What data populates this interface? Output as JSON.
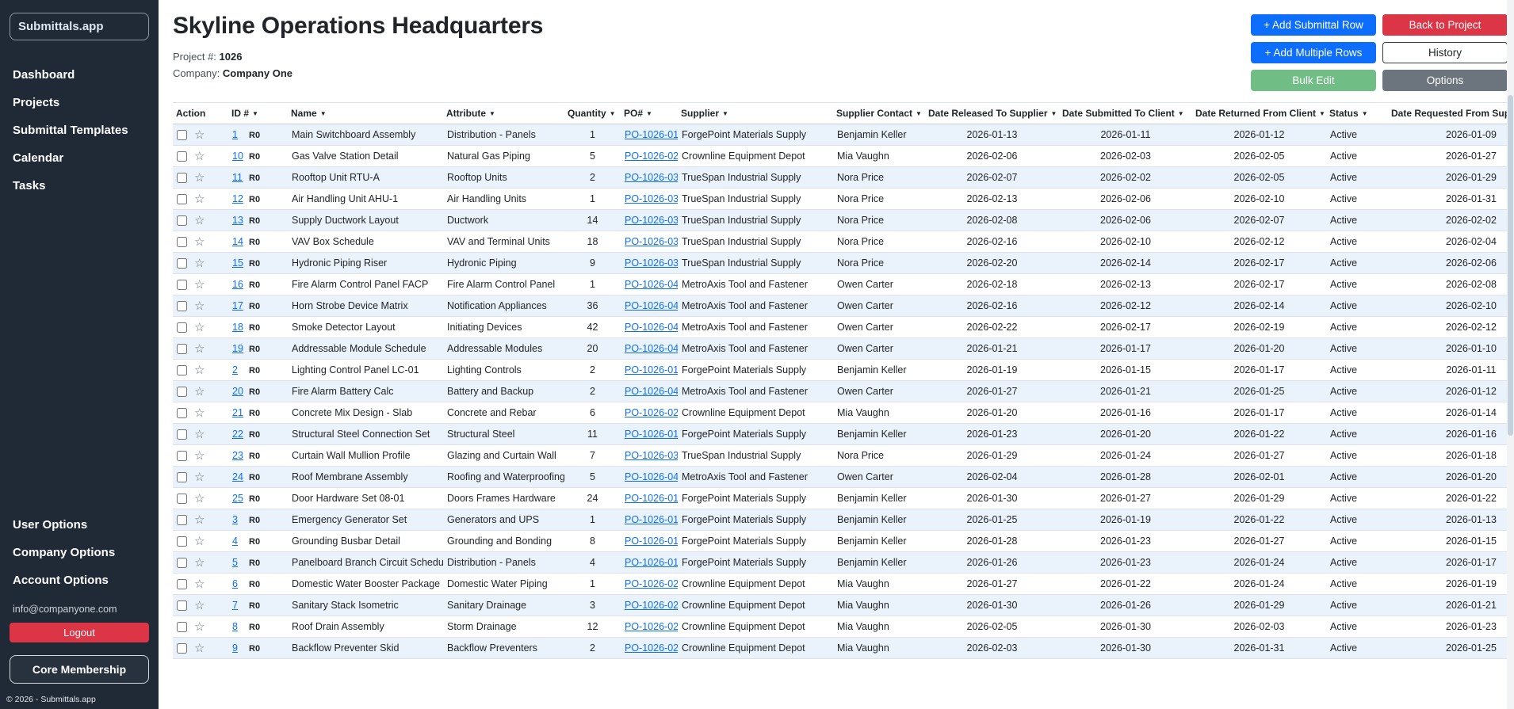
{
  "app": {
    "logo": "Submittals.app",
    "copyright": "© 2026 - Submittals.app"
  },
  "colors": {
    "primary": "#0d6efd",
    "danger": "#dc3545",
    "success": "#70bd86",
    "secondary": "#6c757d",
    "sidebar_bg": "#202a37",
    "row_stripe": "#eaf3fb",
    "link": "#0d6efd"
  },
  "icons": {
    "sort_desc": "▼",
    "star": "☆"
  },
  "sidebar": {
    "nav_items": [
      "Dashboard",
      "Projects",
      "Submittal Templates",
      "Calendar",
      "Tasks"
    ],
    "option_items": [
      "User Options",
      "Company Options",
      "Account Options"
    ],
    "email": "info@companyone.com",
    "logout_label": "Logout",
    "membership_label": "Core Membership"
  },
  "header": {
    "title": "Skyline Operations Headquarters",
    "project_label": "Project #:",
    "project_number": "1026",
    "company_label": "Company:",
    "company_name": "Company One"
  },
  "toolbar": {
    "add_row": "+ Add Submittal Row",
    "back": "Back to Project",
    "add_multiple": "+ Add Multiple Rows",
    "history": "History",
    "bulk_edit": "Bulk Edit",
    "options": "Options"
  },
  "table": {
    "columns": [
      {
        "key": "action",
        "label": "Action",
        "sortable": false
      },
      {
        "key": "id",
        "label": "ID #",
        "sortable": true
      },
      {
        "key": "name",
        "label": "Name",
        "sortable": true
      },
      {
        "key": "attribute",
        "label": "Attribute",
        "sortable": true
      },
      {
        "key": "quantity",
        "label": "Quantity",
        "sortable": true
      },
      {
        "key": "po",
        "label": "PO#",
        "sortable": true
      },
      {
        "key": "supplier",
        "label": "Supplier",
        "sortable": true
      },
      {
        "key": "supplier_contact",
        "label": "Supplier Contact",
        "sortable": true
      },
      {
        "key": "date_released",
        "label": "Date Released To Supplier",
        "sortable": true
      },
      {
        "key": "date_submitted",
        "label": "Date Submitted To Client",
        "sortable": true
      },
      {
        "key": "date_returned",
        "label": "Date Returned From Client",
        "sortable": true
      },
      {
        "key": "status",
        "label": "Status",
        "sortable": true
      },
      {
        "key": "date_requested",
        "label": "Date Requested From Supplier",
        "sortable": true
      }
    ],
    "rows": [
      {
        "id": "1",
        "rev": "R0",
        "name": "Main Switchboard Assembly",
        "attr": "Distribution - Panels",
        "qty": "1",
        "po": "PO-1026-01",
        "supplier": "ForgePoint Materials Supply",
        "contact": "Benjamin Keller",
        "released": "2026-01-13",
        "submitted": "2026-01-11",
        "returned": "2026-01-12",
        "status": "Active",
        "requested": "2026-01-09"
      },
      {
        "id": "10",
        "rev": "R0",
        "name": "Gas Valve Station Detail",
        "attr": "Natural Gas Piping",
        "qty": "5",
        "po": "PO-1026-02",
        "supplier": "Crownline Equipment Depot",
        "contact": "Mia Vaughn",
        "released": "2026-02-06",
        "submitted": "2026-02-03",
        "returned": "2026-02-05",
        "status": "Active",
        "requested": "2026-01-27"
      },
      {
        "id": "11",
        "rev": "R0",
        "name": "Rooftop Unit RTU-A",
        "attr": "Rooftop Units",
        "qty": "2",
        "po": "PO-1026-03",
        "supplier": "TrueSpan Industrial Supply",
        "contact": "Nora Price",
        "released": "2026-02-07",
        "submitted": "2026-02-02",
        "returned": "2026-02-05",
        "status": "Active",
        "requested": "2026-01-29"
      },
      {
        "id": "12",
        "rev": "R0",
        "name": "Air Handling Unit AHU-1",
        "attr": "Air Handling Units",
        "qty": "1",
        "po": "PO-1026-03",
        "supplier": "TrueSpan Industrial Supply",
        "contact": "Nora Price",
        "released": "2026-02-13",
        "submitted": "2026-02-06",
        "returned": "2026-02-10",
        "status": "Active",
        "requested": "2026-01-31"
      },
      {
        "id": "13",
        "rev": "R0",
        "name": "Supply Ductwork Layout",
        "attr": "Ductwork",
        "qty": "14",
        "po": "PO-1026-03",
        "supplier": "TrueSpan Industrial Supply",
        "contact": "Nora Price",
        "released": "2026-02-08",
        "submitted": "2026-02-06",
        "returned": "2026-02-07",
        "status": "Active",
        "requested": "2026-02-02"
      },
      {
        "id": "14",
        "rev": "R0",
        "name": "VAV Box Schedule",
        "attr": "VAV and Terminal Units",
        "qty": "18",
        "po": "PO-1026-03",
        "supplier": "TrueSpan Industrial Supply",
        "contact": "Nora Price",
        "released": "2026-02-16",
        "submitted": "2026-02-10",
        "returned": "2026-02-12",
        "status": "Active",
        "requested": "2026-02-04"
      },
      {
        "id": "15",
        "rev": "R0",
        "name": "Hydronic Piping Riser",
        "attr": "Hydronic Piping",
        "qty": "9",
        "po": "PO-1026-03",
        "supplier": "TrueSpan Industrial Supply",
        "contact": "Nora Price",
        "released": "2026-02-20",
        "submitted": "2026-02-14",
        "returned": "2026-02-17",
        "status": "Active",
        "requested": "2026-02-06"
      },
      {
        "id": "16",
        "rev": "R0",
        "name": "Fire Alarm Control Panel FACP",
        "attr": "Fire Alarm Control Panel",
        "qty": "1",
        "po": "PO-1026-04",
        "supplier": "MetroAxis Tool and Fastener",
        "contact": "Owen Carter",
        "released": "2026-02-18",
        "submitted": "2026-02-13",
        "returned": "2026-02-17",
        "status": "Active",
        "requested": "2026-02-08"
      },
      {
        "id": "17",
        "rev": "R0",
        "name": "Horn Strobe Device Matrix",
        "attr": "Notification Appliances",
        "qty": "36",
        "po": "PO-1026-04",
        "supplier": "MetroAxis Tool and Fastener",
        "contact": "Owen Carter",
        "released": "2026-02-16",
        "submitted": "2026-02-12",
        "returned": "2026-02-14",
        "status": "Active",
        "requested": "2026-02-10"
      },
      {
        "id": "18",
        "rev": "R0",
        "name": "Smoke Detector Layout",
        "attr": "Initiating Devices",
        "qty": "42",
        "po": "PO-1026-04",
        "supplier": "MetroAxis Tool and Fastener",
        "contact": "Owen Carter",
        "released": "2026-02-22",
        "submitted": "2026-02-17",
        "returned": "2026-02-19",
        "status": "Active",
        "requested": "2026-02-12"
      },
      {
        "id": "19",
        "rev": "R0",
        "name": "Addressable Module Schedule",
        "attr": "Addressable Modules",
        "qty": "20",
        "po": "PO-1026-04",
        "supplier": "MetroAxis Tool and Fastener",
        "contact": "Owen Carter",
        "released": "2026-01-21",
        "submitted": "2026-01-17",
        "returned": "2026-01-20",
        "status": "Active",
        "requested": "2026-01-10"
      },
      {
        "id": "2",
        "rev": "R0",
        "name": "Lighting Control Panel LC-01",
        "attr": "Lighting Controls",
        "qty": "2",
        "po": "PO-1026-01",
        "supplier": "ForgePoint Materials Supply",
        "contact": "Benjamin Keller",
        "released": "2026-01-19",
        "submitted": "2026-01-15",
        "returned": "2026-01-17",
        "status": "Active",
        "requested": "2026-01-11"
      },
      {
        "id": "20",
        "rev": "R0",
        "name": "Fire Alarm Battery Calc",
        "attr": "Battery and Backup",
        "qty": "2",
        "po": "PO-1026-04",
        "supplier": "MetroAxis Tool and Fastener",
        "contact": "Owen Carter",
        "released": "2026-01-27",
        "submitted": "2026-01-21",
        "returned": "2026-01-25",
        "status": "Active",
        "requested": "2026-01-12"
      },
      {
        "id": "21",
        "rev": "R0",
        "name": "Concrete Mix Design - Slab",
        "attr": "Concrete and Rebar",
        "qty": "6",
        "po": "PO-1026-02",
        "supplier": "Crownline Equipment Depot",
        "contact": "Mia Vaughn",
        "released": "2026-01-20",
        "submitted": "2026-01-16",
        "returned": "2026-01-17",
        "status": "Active",
        "requested": "2026-01-14"
      },
      {
        "id": "22",
        "rev": "R0",
        "name": "Structural Steel Connection Set",
        "attr": "Structural Steel",
        "qty": "11",
        "po": "PO-1026-01",
        "supplier": "ForgePoint Materials Supply",
        "contact": "Benjamin Keller",
        "released": "2026-01-23",
        "submitted": "2026-01-20",
        "returned": "2026-01-22",
        "status": "Active",
        "requested": "2026-01-16"
      },
      {
        "id": "23",
        "rev": "R0",
        "name": "Curtain Wall Mullion Profile",
        "attr": "Glazing and Curtain Wall",
        "qty": "7",
        "po": "PO-1026-03",
        "supplier": "TrueSpan Industrial Supply",
        "contact": "Nora Price",
        "released": "2026-01-29",
        "submitted": "2026-01-24",
        "returned": "2026-01-27",
        "status": "Active",
        "requested": "2026-01-18"
      },
      {
        "id": "24",
        "rev": "R0",
        "name": "Roof Membrane Assembly",
        "attr": "Roofing and Waterproofing",
        "qty": "5",
        "po": "PO-1026-04",
        "supplier": "MetroAxis Tool and Fastener",
        "contact": "Owen Carter",
        "released": "2026-02-04",
        "submitted": "2026-01-28",
        "returned": "2026-02-01",
        "status": "Active",
        "requested": "2026-01-20"
      },
      {
        "id": "25",
        "rev": "R0",
        "name": "Door Hardware Set 08-01",
        "attr": "Doors Frames Hardware",
        "qty": "24",
        "po": "PO-1026-01",
        "supplier": "ForgePoint Materials Supply",
        "contact": "Benjamin Keller",
        "released": "2026-01-30",
        "submitted": "2026-01-27",
        "returned": "2026-01-29",
        "status": "Active",
        "requested": "2026-01-22"
      },
      {
        "id": "3",
        "rev": "R0",
        "name": "Emergency Generator Set",
        "attr": "Generators and UPS",
        "qty": "1",
        "po": "PO-1026-01",
        "supplier": "ForgePoint Materials Supply",
        "contact": "Benjamin Keller",
        "released": "2026-01-25",
        "submitted": "2026-01-19",
        "returned": "2026-01-22",
        "status": "Active",
        "requested": "2026-01-13"
      },
      {
        "id": "4",
        "rev": "R0",
        "name": "Grounding Busbar Detail",
        "attr": "Grounding and Bonding",
        "qty": "8",
        "po": "PO-1026-01",
        "supplier": "ForgePoint Materials Supply",
        "contact": "Benjamin Keller",
        "released": "2026-01-28",
        "submitted": "2026-01-23",
        "returned": "2026-01-27",
        "status": "Active",
        "requested": "2026-01-15"
      },
      {
        "id": "5",
        "rev": "R0",
        "name": "Panelboard Branch Circuit Schedule",
        "attr": "Distribution - Panels",
        "qty": "4",
        "po": "PO-1026-01",
        "supplier": "ForgePoint Materials Supply",
        "contact": "Benjamin Keller",
        "released": "2026-01-26",
        "submitted": "2026-01-23",
        "returned": "2026-01-24",
        "status": "Active",
        "requested": "2026-01-17"
      },
      {
        "id": "6",
        "rev": "R0",
        "name": "Domestic Water Booster Package",
        "attr": "Domestic Water Piping",
        "qty": "1",
        "po": "PO-1026-02",
        "supplier": "Crownline Equipment Depot",
        "contact": "Mia Vaughn",
        "released": "2026-01-27",
        "submitted": "2026-01-22",
        "returned": "2026-01-24",
        "status": "Active",
        "requested": "2026-01-19"
      },
      {
        "id": "7",
        "rev": "R0",
        "name": "Sanitary Stack Isometric",
        "attr": "Sanitary Drainage",
        "qty": "3",
        "po": "PO-1026-02",
        "supplier": "Crownline Equipment Depot",
        "contact": "Mia Vaughn",
        "released": "2026-01-30",
        "submitted": "2026-01-26",
        "returned": "2026-01-29",
        "status": "Active",
        "requested": "2026-01-21"
      },
      {
        "id": "8",
        "rev": "R0",
        "name": "Roof Drain Assembly",
        "attr": "Storm Drainage",
        "qty": "12",
        "po": "PO-1026-02",
        "supplier": "Crownline Equipment Depot",
        "contact": "Mia Vaughn",
        "released": "2026-02-05",
        "submitted": "2026-01-30",
        "returned": "2026-02-03",
        "status": "Active",
        "requested": "2026-01-23"
      },
      {
        "id": "9",
        "rev": "R0",
        "name": "Backflow Preventer Skid",
        "attr": "Backflow Preventers",
        "qty": "2",
        "po": "PO-1026-02",
        "supplier": "Crownline Equipment Depot",
        "contact": "Mia Vaughn",
        "released": "2026-02-03",
        "submitted": "2026-01-30",
        "returned": "2026-01-31",
        "status": "Active",
        "requested": "2026-01-25"
      }
    ]
  }
}
